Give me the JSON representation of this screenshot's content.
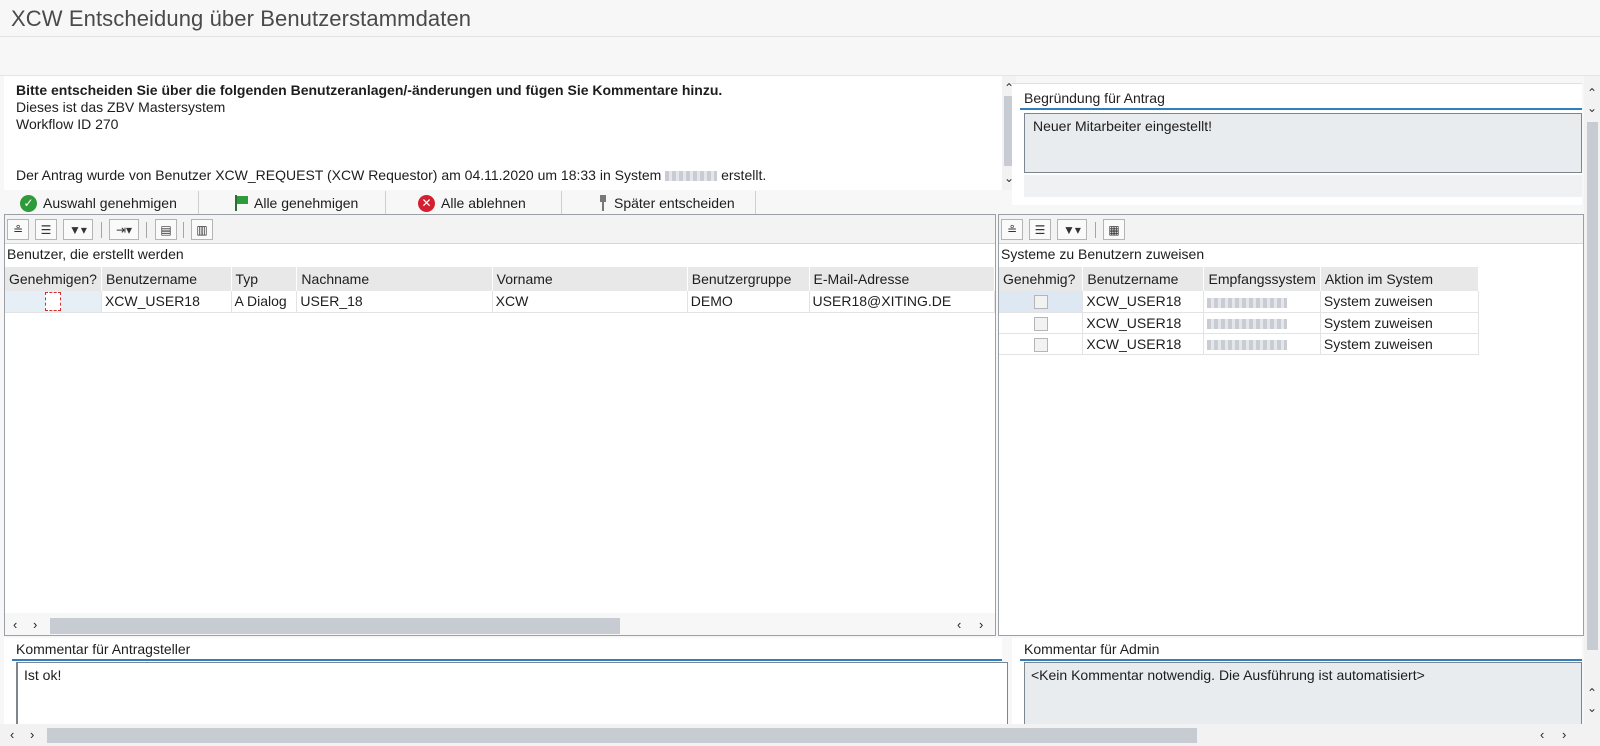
{
  "window": {
    "title": "XCW Entscheidung über Benutzerstammdaten"
  },
  "info": {
    "heading": "Bitte entscheiden Sie über die folgenden Benutzeranlagen/-änderungen und fügen Sie Kommentare hinzu.",
    "line1": "Dieses ist das ZBV Mastersystem",
    "line2": "Workflow ID 270",
    "request_prefix": "Der Antrag wurde von Benutzer XCW_REQUEST (XCW Requestor) am 04.11.2020 um 18:33 in System",
    "request_suffix": "erstellt."
  },
  "reason": {
    "label": "Begründung für Antrag",
    "text": "Neuer Mitarbeiter eingestellt!"
  },
  "actions": {
    "approve_selection": "Auswahl genehmigen",
    "approve_all": "Alle genehmigen",
    "reject_all": "Alle ablehnen",
    "decide_later": "Später entscheiden"
  },
  "users": {
    "title": "Benutzer, die erstellt werden",
    "columns": [
      "Genehmigen?",
      "Benutzername",
      "Typ",
      "Nachname",
      "Vorname",
      "Benutzergruppe",
      "E-Mail-Adresse"
    ],
    "rows": [
      {
        "username": "XCW_USER18",
        "type": "A Dialog",
        "lastname": "USER_18",
        "firstname": "XCW",
        "group": "DEMO",
        "email": "USER18@XITING.DE"
      }
    ]
  },
  "systems": {
    "title": "Systeme zu Benutzern zuweisen",
    "columns": [
      "Genehmig?",
      "Benutzername",
      "Empfangssystem",
      "Aktion im System"
    ],
    "rows": [
      {
        "username": "XCW_USER18",
        "action": "System zuweisen"
      },
      {
        "username": "XCW_USER18",
        "action": "System zuweisen"
      },
      {
        "username": "XCW_USER18",
        "action": "System zuweisen"
      }
    ]
  },
  "comments": {
    "requester_label": "Kommentar für Antragsteller",
    "requester_text": "Ist ok!",
    "admin_label": "Kommentar für Admin",
    "admin_text": "<Kein Kommentar notwendig. Die Ausführung ist automatisiert>"
  },
  "colors": {
    "accent": "#2f7fc1",
    "approve": "#2e9a3a",
    "reject": "#d32030"
  }
}
